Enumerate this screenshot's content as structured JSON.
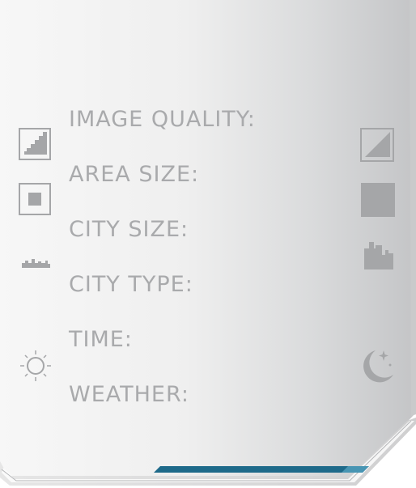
{
  "settings": {
    "rows": [
      {
        "label": "IMAGE QUALITY:",
        "min_icon": "staircase-quality-low-icon",
        "max_icon": "diagonal-quality-high-icon"
      },
      {
        "label": "AREA SIZE:",
        "min_icon": "small-square-icon",
        "max_icon": "large-square-icon"
      },
      {
        "label": "CITY SIZE:",
        "min_icon": "small-city-icon",
        "max_icon": "large-city-icon"
      },
      {
        "label": "CITY TYPE:",
        "min_icon": "",
        "max_icon": ""
      },
      {
        "label": "TIME:",
        "min_icon": "sun-icon",
        "max_icon": "moon-icon"
      },
      {
        "label": "WEATHER:",
        "min_icon": "",
        "max_icon": ""
      }
    ]
  },
  "footer": {
    "progress_fraction": 0.5
  },
  "colors": {
    "label": "#a9aaac",
    "icon": "#a5a6a8",
    "accent": "#1e6a8a",
    "panel_light": "#f5f5f5",
    "panel_dark": "#c2c3c5"
  }
}
